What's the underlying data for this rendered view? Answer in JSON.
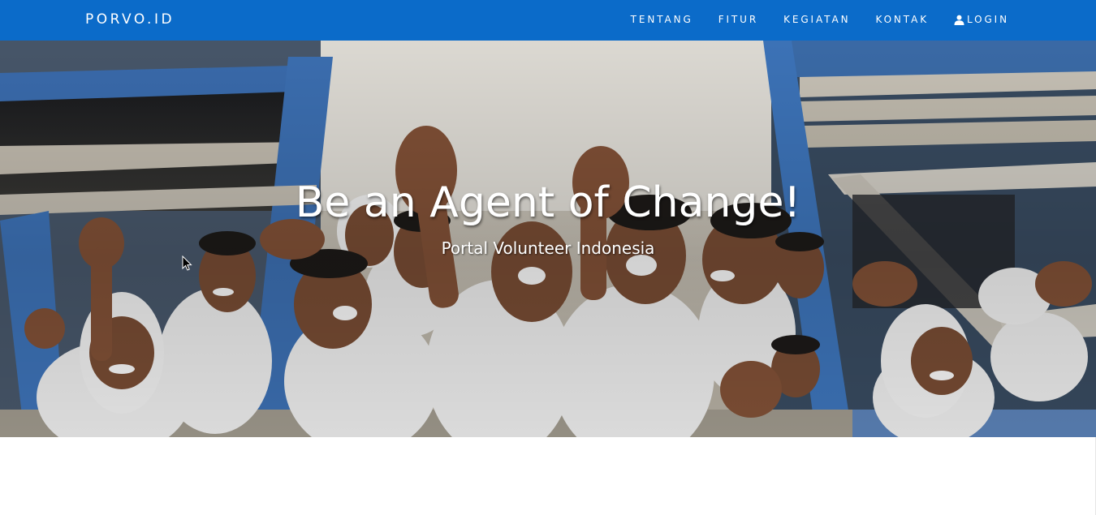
{
  "navbar": {
    "brand": "PORVO.ID",
    "background": "#0b6bc9",
    "items": [
      {
        "label": "TENTANG"
      },
      {
        "label": "FITUR"
      },
      {
        "label": "KEGIATAN"
      },
      {
        "label": "KONTAK"
      },
      {
        "label": "LOGIN",
        "icon": "user-icon"
      }
    ]
  },
  "hero": {
    "title": "Be an Agent of Change!",
    "subtitle": "Portal Volunteer Indonesia",
    "image": "photo of smiling schoolchildren waving from windows"
  }
}
